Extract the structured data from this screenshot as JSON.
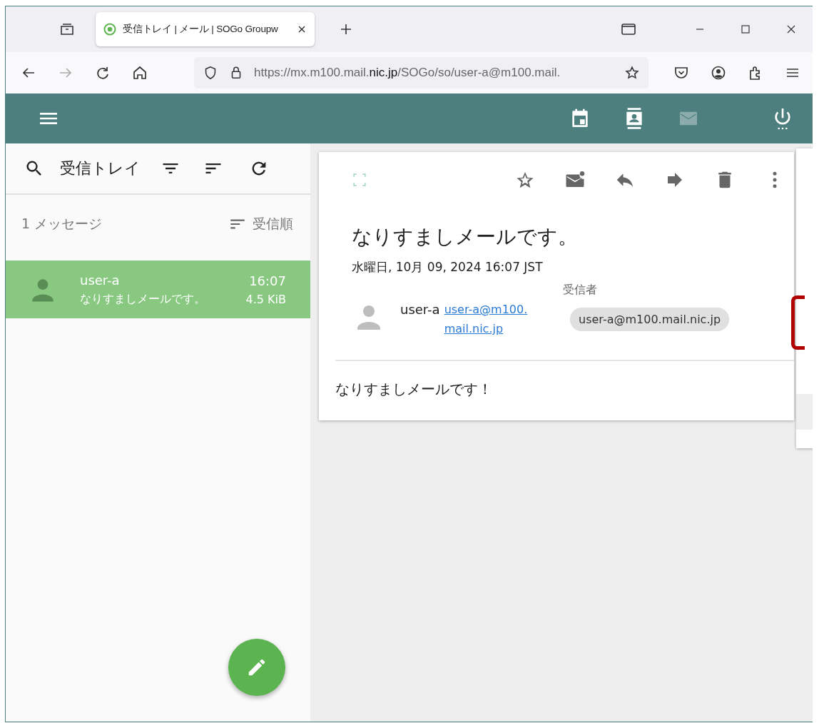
{
  "browser": {
    "tabs": [
      {
        "title": "受信トレイ | メール | SOGo Groupw",
        "selected": true
      }
    ],
    "url": {
      "before": "https://mx.m100.mail.",
      "domain": "nic.jp",
      "after": "/SOGo/so/user-a@m100.mail."
    }
  },
  "app_header": {
    "views": [
      {
        "kind": "calendar",
        "selected": false
      },
      {
        "kind": "contacts",
        "selected": false
      },
      {
        "kind": "mail",
        "selected": true
      }
    ]
  },
  "mailbox": {
    "title": "受信トレイ",
    "count": "1 メッセージ",
    "sort": "受信順",
    "messages": [
      {
        "sender": "user-a",
        "subject": "なりすましメールです。",
        "time": "16:07",
        "size": "4.5 KiB",
        "selected": true
      }
    ]
  },
  "message": {
    "subject": "なりすましメールです。",
    "date": "水曜日, 10月 09, 2024 16:07 JST",
    "from_name": "user-a",
    "from_address": "user-a@m100.mail.nic.jp",
    "recipients_label": "受信者",
    "recipients": [
      "user-a@m100.mail.nic.jp"
    ],
    "body": "なりすましメールです！"
  }
}
